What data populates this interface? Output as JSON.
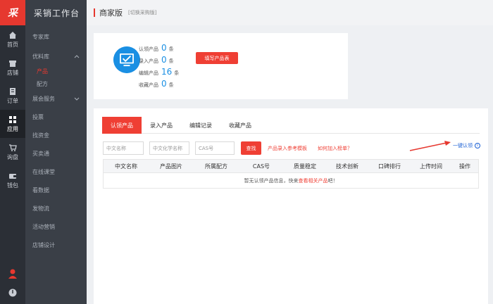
{
  "rail": {
    "logo": "采",
    "items": [
      {
        "label": "首页",
        "icon": "home-icon"
      },
      {
        "label": "店铺",
        "icon": "store-icon"
      },
      {
        "label": "订单",
        "icon": "order-icon"
      },
      {
        "label": "应用",
        "icon": "apps-icon"
      },
      {
        "label": "询盘",
        "icon": "cart-icon"
      },
      {
        "label": "钱包",
        "icon": "wallet-icon"
      }
    ],
    "bottom_icons": [
      "user-icon",
      "power-icon"
    ]
  },
  "sidebar": {
    "brand": "采销工作台",
    "items": [
      {
        "label": "专家库"
      },
      {
        "label": "优料库",
        "expanded": true,
        "children": [
          {
            "label": "产品",
            "active": true
          },
          {
            "label": "配方"
          }
        ]
      },
      {
        "label": "展会服务",
        "collapsed": true
      },
      {
        "label": "投票"
      },
      {
        "label": "找资金"
      },
      {
        "label": "买卖通"
      },
      {
        "label": "在线课堂"
      },
      {
        "label": "看数据"
      },
      {
        "label": "发物流"
      },
      {
        "label": "活动营销"
      },
      {
        "label": "店铺设计"
      }
    ]
  },
  "topbar": {
    "title": "商家版",
    "switch_label": "[切换采购版]"
  },
  "summary": {
    "icon": "monitor-check-icon",
    "stats": [
      {
        "label": "认领产品",
        "value": "0",
        "unit": "条"
      },
      {
        "label": "录入产品",
        "value": "0",
        "unit": "条"
      },
      {
        "label": "编辑产品",
        "value": "16",
        "unit": "条"
      },
      {
        "label": "收藏产品",
        "value": "0",
        "unit": "条"
      }
    ],
    "fill_button": "填写产品表"
  },
  "main": {
    "tabs": [
      "认领产品",
      "录入产品",
      "编辑记录",
      "收藏产品"
    ],
    "active_tab": 0,
    "filters": {
      "cn_name_placeholder": "中文名称",
      "cn_chem_placeholder": "中文化学名称",
      "cas_placeholder": "CAS号",
      "search_button": "查找"
    },
    "links": {
      "template": "产品录入参考模板",
      "howto": "如何加入榜单？"
    },
    "one_click": "一键认领",
    "table": {
      "headers": [
        "中文名称",
        "产品图片",
        "所属配方",
        "CAS号",
        "质量稳定",
        "技术创新",
        "口碑排行",
        "上传时间",
        "操作"
      ],
      "empty_prefix": "暂无认领产品信息，快来",
      "empty_link": "查看相关产品",
      "empty_suffix": "吧！"
    }
  },
  "colors": {
    "accent": "#ef3f34",
    "link_blue": "#1a5fd4",
    "number_blue": "#1a8fe3",
    "rail_bg": "#2b2f36",
    "sidebar_bg": "#3a3f47"
  }
}
